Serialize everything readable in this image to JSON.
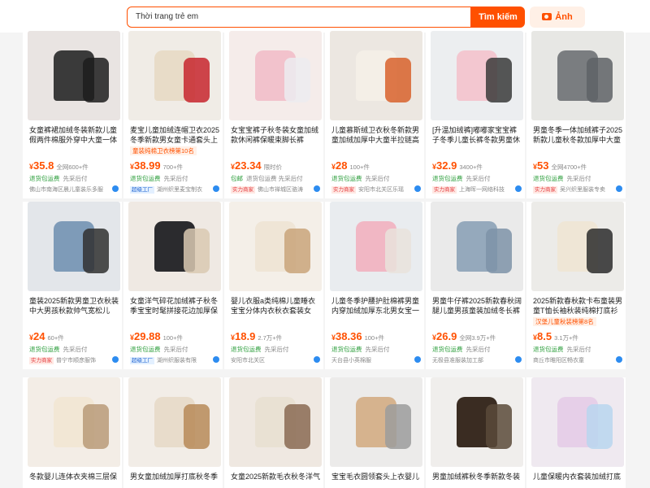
{
  "search": {
    "value": "Thời trang trẻ em",
    "button_label": "Tìm kiếm",
    "image_button_label": "Ảnh"
  },
  "colors": {
    "accent": "#ff5000",
    "green": "#2a9d3a"
  },
  "products": [
    {
      "title": "女童裤裙加绒冬装新款儿童假两件棉服外穿中大童一体",
      "price": "35.8",
      "sold": "全网600+件",
      "svc": "退货包运费",
      "svc2": "先采后付",
      "badge": "",
      "shop": "佛山市南海区晨儿童装乐多服",
      "tag": "",
      "bg": "#e9e4e2",
      "fg": "#3a3a3a",
      "fg2": "#1d1d1d"
    },
    {
      "title": "麦宝儿童加绒连帽卫衣2025冬季新款男女童卡通套头上衣",
      "price": "38.99",
      "sold": "700+件",
      "svc": "退货包运费",
      "svc2": "先采后付",
      "badge": "超级工厂",
      "shop": "湖州织里麦宝制衣",
      "tag": "童装纯棉卫衣榜第10名",
      "bg": "#f0ece6",
      "fg": "#e8dcc8",
      "fg2": "#c7262d"
    },
    {
      "title": "女宝宝裤子秋冬装女童加绒款休闲裤保暖束脚长裤",
      "price": "23.34",
      "sold": "限时价",
      "svc": "包邮",
      "svc2": "退货包运费 先采后付",
      "badge": "实力商家",
      "shop": "佛山市禅城区骆涛",
      "tag": "",
      "bg": "#f5ecea",
      "fg": "#f2c2cc",
      "fg2": "#ececf0"
    },
    {
      "title": "儿童慕斯绒卫衣秋冬新款男童加绒加厚中大童半拉链高",
      "price": "28",
      "sold": "100+件",
      "svc": "退货包运费",
      "svc2": "先采后付",
      "badge": "实力商家",
      "shop": "安阳市北关区乐瑶",
      "tag": "",
      "bg": "#ece7e1",
      "fg": "#f4efe7",
      "fg2": "#d8622b"
    },
    {
      "title": "[升温加绒裤]嘟嘟家宝宝裤子冬季儿童长裤冬款男童休",
      "price": "32.9",
      "sold": "3400+件",
      "svc": "退货包运费",
      "svc2": "先采后付",
      "badge": "实力商家",
      "shop": "上海晖一网络科技",
      "tag": "",
      "bg": "#eceef0",
      "fg": "#f3c7d0",
      "fg2": "#3a3a3a"
    },
    {
      "title": "男童冬季一体加绒裤子2025新款儿童秋冬款加厚中大童",
      "price": "53",
      "sold": "全网4700+件",
      "svc": "退货包运费",
      "svc2": "先采后付",
      "badge": "实力商家",
      "shop": "吴兴织里服装专卖",
      "tag": "",
      "bg": "#e7e7e4",
      "fg": "#7a7d80",
      "fg2": "#5e6166"
    },
    {
      "title": "童装2025新款男童卫衣秋装中大男孩秋款帅气宽松儿",
      "price": "24",
      "sold": "60+件",
      "svc": "退货包运费",
      "svc2": "先采后付",
      "badge": "实力商家",
      "shop": "普宁市顺彦服饰",
      "tag": "",
      "bg": "#e3e6ea",
      "fg": "#7e9bb8",
      "fg2": "#303030"
    },
    {
      "title": "女童洋气碎花加绒裤子秋冬季宝宝时髦拼接花边加厚保",
      "price": "29.88",
      "sold": "100+件",
      "svc": "退货包运费",
      "svc2": "先采后付",
      "badge": "超级工厂",
      "shop": "湖州织服装有限",
      "tag": "",
      "bg": "#efe9e3",
      "fg": "#2b2b2e",
      "fg2": "#d9c9b2"
    },
    {
      "title": "婴儿衣服a类纯棉儿童睡衣宝宝分体内衣秋衣套装女",
      "price": "18.9",
      "sold": "2.7万+件",
      "svc": "退货包运费",
      "svc2": "先采后付",
      "badge": "",
      "shop": "安阳市北关区",
      "tag": "",
      "bg": "#f4efe8",
      "fg": "#efe5d6",
      "fg2": "#c9a57a"
    },
    {
      "title": "儿童冬季护腰护肚棉裤男童内穿加绒加厚东北男女宝一",
      "price": "38.36",
      "sold": "100+件",
      "svc": "退货包运费",
      "svc2": "先采后付",
      "badge": "",
      "shop": "天台县小英棉服",
      "tag": "",
      "bg": "#e9ecef",
      "fg": "#f1b7c4",
      "fg2": "#e9e3dc"
    },
    {
      "title": "男童牛仔裤2025新款春秋阔腿儿童男孩童装加绒冬长裤",
      "price": "26.9",
      "sold": "全网3.9万+件",
      "svc": "退货包运费",
      "svc2": "先采后付",
      "badge": "",
      "shop": "无极县准服装加工部",
      "tag": "",
      "bg": "#eaeaea",
      "fg": "#95a9bc",
      "fg2": "#7e93a8"
    },
    {
      "title": "2025新款春秋款卡布童装男童T恤长袖秋装纯棉打底衫",
      "price": "8.5",
      "sold": "3.1万+件",
      "svc": "退货包运费",
      "svc2": "先采后付",
      "badge": "",
      "shop": "商丘市睢阳区畅衣童",
      "tag": "汉堡儿童秋装榜第8名",
      "bg": "#ecebe8",
      "fg": "#efe6d6",
      "fg2": "#2c2c2c"
    },
    {
      "title": "冬款婴儿连体衣夹棉三层保",
      "price": "",
      "sold": "",
      "svc": "",
      "svc2": "",
      "badge": "",
      "shop": "",
      "tag": "",
      "bg": "#f3ede6",
      "fg": "#f2e7d5",
      "fg2": "#b89a78"
    },
    {
      "title": "男女童加绒加厚打底秋冬季",
      "price": "",
      "sold": "",
      "svc": "",
      "svc2": "",
      "badge": "",
      "shop": "",
      "tag": "",
      "bg": "#f2ede7",
      "fg": "#e8dccb",
      "fg2": "#b78a58"
    },
    {
      "title": "女童2025新款毛衣秋冬洋气",
      "price": "",
      "sold": "",
      "svc": "",
      "svc2": "",
      "badge": "",
      "shop": "",
      "tag": "",
      "bg": "#efe8e1",
      "fg": "#e9e1d3",
      "fg2": "#8a6a52"
    },
    {
      "title": "宝宝毛衣圆领套头上衣婴儿",
      "price": "",
      "sold": "",
      "svc": "",
      "svc2": "",
      "badge": "",
      "shop": "",
      "tag": "",
      "bg": "#ecebea",
      "fg": "#d6b38e",
      "fg2": "#9c9c9c"
    },
    {
      "title": "男童加绒裤秋冬季新款冬装",
      "price": "",
      "sold": "",
      "svc": "",
      "svc2": "",
      "badge": "",
      "shop": "",
      "tag": "",
      "bg": "#f0eeec",
      "fg": "#3a2c22",
      "fg2": "#5a4a3a"
    },
    {
      "title": "儿童保暖内衣套装加绒打底",
      "price": "",
      "sold": "",
      "svc": "",
      "svc2": "",
      "badge": "",
      "shop": "",
      "tag": "",
      "bg": "#efe9f0",
      "fg": "#e6cfe8",
      "fg2": "#b8d6ee"
    }
  ]
}
